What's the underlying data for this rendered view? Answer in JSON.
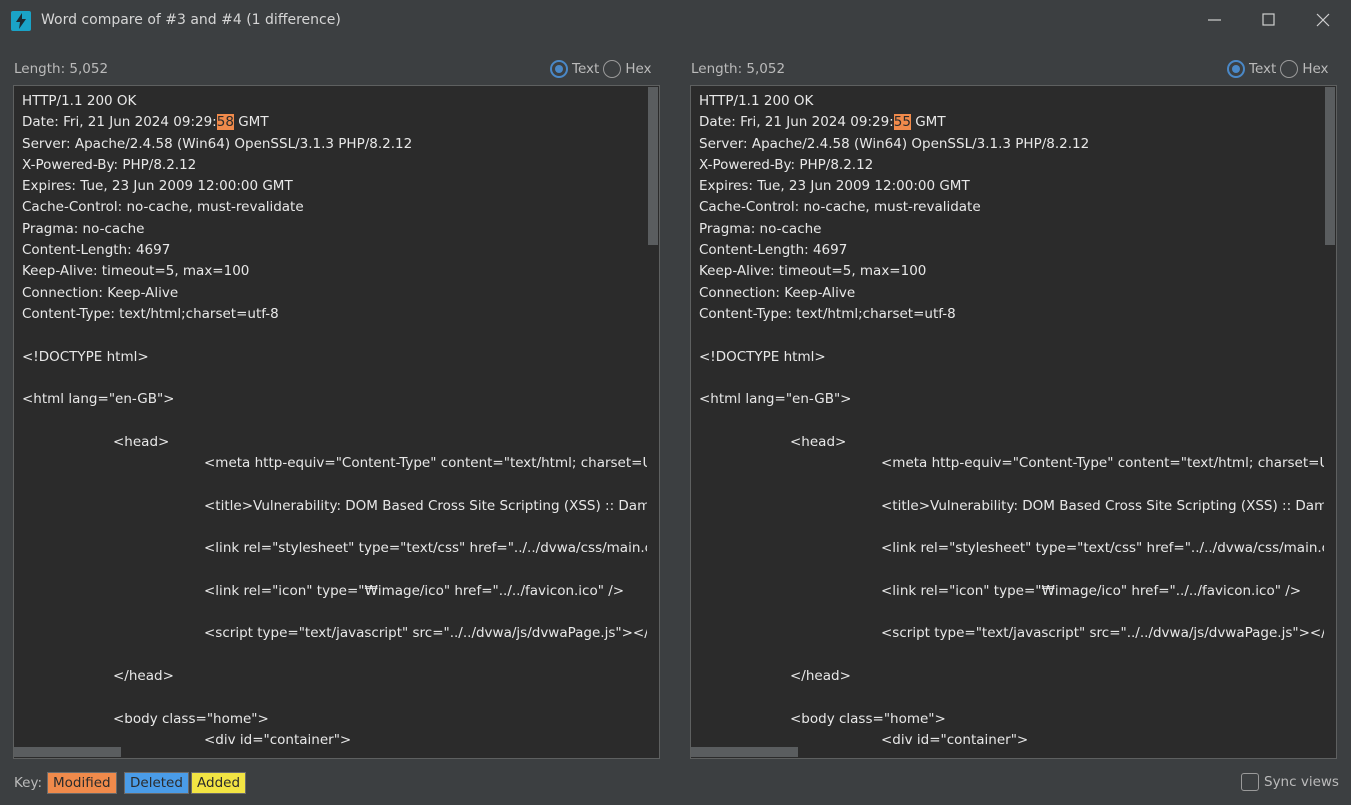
{
  "window": {
    "title": "Word compare of #3 and #4  (1 difference)",
    "icon": "lightning-icon",
    "controls": [
      "minimize-icon",
      "maximize-icon",
      "close-icon"
    ]
  },
  "left": {
    "length": "Length: 5,052",
    "radio": {
      "text": "Text",
      "hex": "Hex",
      "selected": "Text"
    },
    "lines": [
      {
        "t": "HTTP/1.1 200 OK"
      },
      {
        "pre": "Date: Fri, 21 Jun 2024 09:29:",
        "mod": "58",
        "post": " GMT"
      },
      {
        "t": "Server: Apache/2.4.58 (Win64) OpenSSL/3.1.3 PHP/8.2.12"
      },
      {
        "t": "X-Powered-By: PHP/8.2.12"
      },
      {
        "t": "Expires: Tue, 23 Jun 2009 12:00:00 GMT"
      },
      {
        "t": "Cache-Control: no-cache, must-revalidate"
      },
      {
        "t": "Pragma: no-cache"
      },
      {
        "t": "Content-Length: 4697"
      },
      {
        "t": "Keep-Alive: timeout=5, max=100"
      },
      {
        "t": "Connection: Keep-Alive"
      },
      {
        "t": "Content-Type: text/html;charset=utf-8"
      },
      {
        "t": ""
      },
      {
        "t": "<!DOCTYPE html>"
      },
      {
        "t": ""
      },
      {
        "t": "<html lang=\"en-GB\">"
      },
      {
        "t": ""
      },
      {
        "t": "<head>",
        "indent": 1
      },
      {
        "t": "<meta http-equiv=\"Content-Type\" content=\"text/html; charset=U",
        "indent": 2
      },
      {
        "t": ""
      },
      {
        "t": "<title>Vulnerability: DOM Based Cross Site Scripting (XSS) :: Dam",
        "indent": 2
      },
      {
        "t": ""
      },
      {
        "t": "<link rel=\"stylesheet\" type=\"text/css\" href=\"../../dvwa/css/main.cs",
        "indent": 2
      },
      {
        "t": ""
      },
      {
        "t": "<link rel=\"icon\" type=\"₩image/ico\" href=\"../../favicon.ico\" />",
        "indent": 2
      },
      {
        "t": ""
      },
      {
        "t": "<script type=\"text/javascript\" src=\"../../dvwa/js/dvwaPage.js\"></s",
        "indent": 2
      },
      {
        "t": ""
      },
      {
        "t": "</head>",
        "indent": 1
      },
      {
        "t": ""
      },
      {
        "t": "<body class=\"home\">",
        "indent": 1
      },
      {
        "t": "<div id=\"container\">",
        "indent": 2
      }
    ]
  },
  "right": {
    "length": "Length: 5,052",
    "radio": {
      "text": "Text",
      "hex": "Hex",
      "selected": "Text"
    },
    "lines": [
      {
        "t": "HTTP/1.1 200 OK"
      },
      {
        "pre": "Date: Fri, 21 Jun 2024 09:29:",
        "mod": "55",
        "post": " GMT"
      },
      {
        "t": "Server: Apache/2.4.58 (Win64) OpenSSL/3.1.3 PHP/8.2.12"
      },
      {
        "t": "X-Powered-By: PHP/8.2.12"
      },
      {
        "t": "Expires: Tue, 23 Jun 2009 12:00:00 GMT"
      },
      {
        "t": "Cache-Control: no-cache, must-revalidate"
      },
      {
        "t": "Pragma: no-cache"
      },
      {
        "t": "Content-Length: 4697"
      },
      {
        "t": "Keep-Alive: timeout=5, max=100"
      },
      {
        "t": "Connection: Keep-Alive"
      },
      {
        "t": "Content-Type: text/html;charset=utf-8"
      },
      {
        "t": ""
      },
      {
        "t": "<!DOCTYPE html>"
      },
      {
        "t": ""
      },
      {
        "t": "<html lang=\"en-GB\">"
      },
      {
        "t": ""
      },
      {
        "t": "<head>",
        "indent": 1
      },
      {
        "t": "<meta http-equiv=\"Content-Type\" content=\"text/html; charset=U",
        "indent": 2
      },
      {
        "t": ""
      },
      {
        "t": "<title>Vulnerability: DOM Based Cross Site Scripting (XSS) :: Dam",
        "indent": 2
      },
      {
        "t": ""
      },
      {
        "t": "<link rel=\"stylesheet\" type=\"text/css\" href=\"../../dvwa/css/main.cs",
        "indent": 2
      },
      {
        "t": ""
      },
      {
        "t": "<link rel=\"icon\" type=\"₩image/ico\" href=\"../../favicon.ico\" />",
        "indent": 2
      },
      {
        "t": ""
      },
      {
        "t": "<script type=\"text/javascript\" src=\"../../dvwa/js/dvwaPage.js\"></s",
        "indent": 2
      },
      {
        "t": ""
      },
      {
        "t": "</head>",
        "indent": 1
      },
      {
        "t": ""
      },
      {
        "t": "<body class=\"home\">",
        "indent": 1
      },
      {
        "t": "<div id=\"container\">",
        "indent": 2
      }
    ]
  },
  "footer": {
    "key_label": "Key:",
    "modified": "Modified",
    "deleted": "Deleted",
    "added": "Added",
    "sync_views": "Sync views"
  },
  "colors": {
    "modified": "#f08a4b",
    "deleted": "#4a9ce8",
    "added": "#f2e443",
    "radio_accent": "#4a88c7",
    "app_icon": "#1aa3c7"
  }
}
